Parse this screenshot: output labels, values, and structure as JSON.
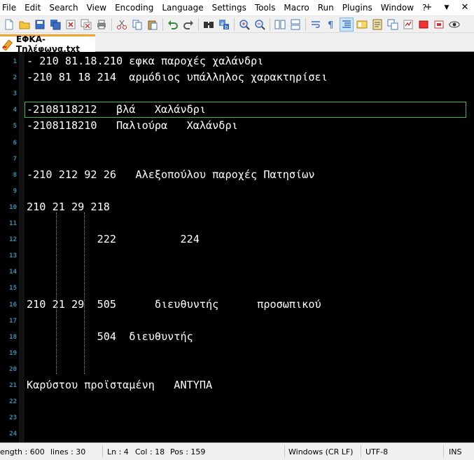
{
  "menu": {
    "items": [
      "File",
      "Edit",
      "Search",
      "View",
      "Encoding",
      "Language",
      "Settings",
      "Tools",
      "Macro",
      "Run",
      "Plugins",
      "Window",
      "?"
    ],
    "window_controls": [
      "+",
      "▼",
      "✕"
    ]
  },
  "toolbar": {
    "icons": [
      "new-file-icon",
      "open-file-icon",
      "save-icon",
      "save-all-icon",
      "close-icon",
      "close-all-icon",
      "print-icon",
      "cut-icon",
      "copy-icon",
      "paste-icon",
      "undo-icon",
      "redo-icon",
      "find-icon",
      "replace-icon",
      "zoom-in-icon",
      "zoom-out-icon",
      "sync-vertical-icon",
      "sync-horizontal-icon",
      "word-wrap-icon",
      "show-all-chars-icon",
      "indent-guide-icon",
      "document-map-icon",
      "function-list-icon",
      "folder-workspace-icon",
      "monitoring-icon",
      "record-macro-icon",
      "stop-record-icon",
      "play-macro-icon"
    ]
  },
  "tab": {
    "label": "ΕΦΚΑ-Τηλέφωνα.txt"
  },
  "editor": {
    "lines": [
      {
        "num": "1",
        "text": "- 210 81.18.210 εφκα παροχές χαλάνδρι"
      },
      {
        "num": "2",
        "text": "-210 81 18 214  αρμόδιος υπάλληλος χαρακτηρίσει"
      },
      {
        "num": "3",
        "text": ""
      },
      {
        "num": "4",
        "text": "-2108118212   βλά   Χαλάνδρι"
      },
      {
        "num": "5",
        "text": "-2108118210   Παλιούρα   Χαλάνδρι"
      },
      {
        "num": "6",
        "text": ""
      },
      {
        "num": "7",
        "text": ""
      },
      {
        "num": "8",
        "text": "-210 212 92 26   Αλεξοπούλου παροχές Πατησίων"
      },
      {
        "num": "9",
        "text": ""
      },
      {
        "num": "10",
        "text": "210 21 29 218"
      },
      {
        "num": "11",
        "text": ""
      },
      {
        "num": "12",
        "text": "           222          224"
      },
      {
        "num": "13",
        "text": ""
      },
      {
        "num": "14",
        "text": ""
      },
      {
        "num": "15",
        "text": ""
      },
      {
        "num": "16",
        "text": "210 21 29  505      διευθυντής      προσωπικού"
      },
      {
        "num": "17",
        "text": ""
      },
      {
        "num": "18",
        "text": "           504  διευθυντής"
      },
      {
        "num": "19",
        "text": ""
      },
      {
        "num": "20",
        "text": ""
      },
      {
        "num": "21",
        "text": "Καρύστου προϊσταμένη   ΑΝΤΥΠΑ"
      },
      {
        "num": "22",
        "text": ""
      },
      {
        "num": "23",
        "text": ""
      },
      {
        "num": "24",
        "text": ""
      }
    ]
  },
  "status": {
    "length": "ength : 600",
    "lines": "lines : 30",
    "ln": "Ln : 4",
    "col": "Col : 18",
    "pos": "Pos : 159",
    "eol": "Windows (CR LF)",
    "encoding": "UTF-8",
    "mode": "INS"
  },
  "colors": {
    "editor_bg": "#000000",
    "text": "#ffffff",
    "line_numbers": "#2b91af",
    "current_line_border": "#3fb94d",
    "tab_accent": "#f4a430"
  }
}
